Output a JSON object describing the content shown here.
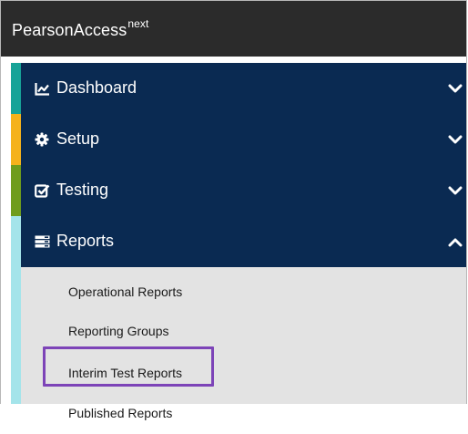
{
  "header": {
    "brand": "PearsonAccess",
    "brand_sup": "next"
  },
  "nav": {
    "items": [
      {
        "label": "Dashboard",
        "icon": "chart-line-icon",
        "accent": "#17a398",
        "chevron": "chevron-down-icon"
      },
      {
        "label": "Setup",
        "icon": "gear-icon",
        "accent": "#f5b21b",
        "chevron": "chevron-down-icon"
      },
      {
        "label": "Testing",
        "icon": "checkbox-icon",
        "accent": "#6f9c1c",
        "chevron": "chevron-down-icon"
      },
      {
        "label": "Reports",
        "icon": "reports-icon",
        "accent": "#a4e4ea",
        "chevron": "chevron-up-icon"
      }
    ],
    "reports_subitems": [
      "Operational Reports",
      "Reporting Groups",
      "Interim Test Reports",
      "Published Reports"
    ],
    "highlighted_subitem": "Interim Test Reports"
  },
  "colors": {
    "header_bg": "#2b2b2b",
    "nav_bg": "#0a2a52",
    "submenu_bg": "#e3e3e3",
    "highlight": "#7d44b8"
  }
}
